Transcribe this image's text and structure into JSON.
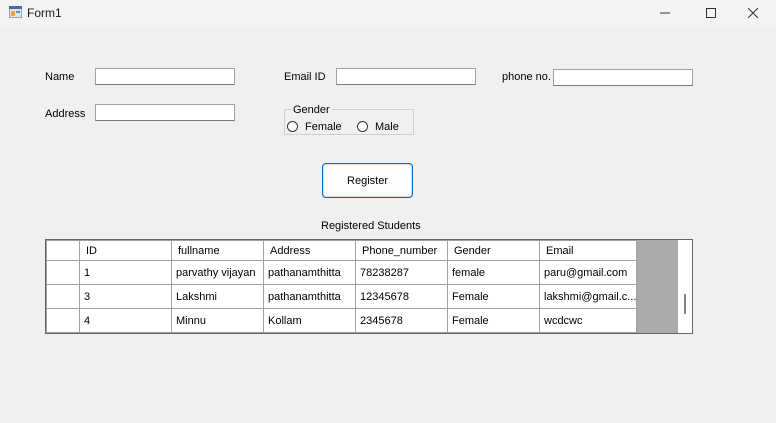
{
  "window": {
    "title": "Form1"
  },
  "form": {
    "name_label": "Name",
    "email_label": "Email ID",
    "phone_label": "phone no.",
    "address_label": "Address",
    "name_value": "",
    "email_value": "",
    "phone_value": "",
    "address_value": "",
    "gender_group_title": "Gender",
    "gender_options": [
      "Female",
      "Male"
    ],
    "register_label": "Register",
    "grid_caption": "Registered Students"
  },
  "grid": {
    "columns": [
      "ID",
      "fullname",
      "Address",
      "Phone_number",
      "Gender",
      "Email"
    ],
    "rows": [
      [
        "1",
        "parvathy vijayan",
        "pathanamthitta",
        "78238287",
        "female",
        "paru@gmail.com"
      ],
      [
        "3",
        "Lakshmi",
        "pathanamthitta",
        "12345678",
        "Female",
        "lakshmi@gmail.c..."
      ],
      [
        "4",
        "Minnu",
        "Kollam",
        "2345678",
        "Female",
        "wcdcwc"
      ]
    ]
  }
}
